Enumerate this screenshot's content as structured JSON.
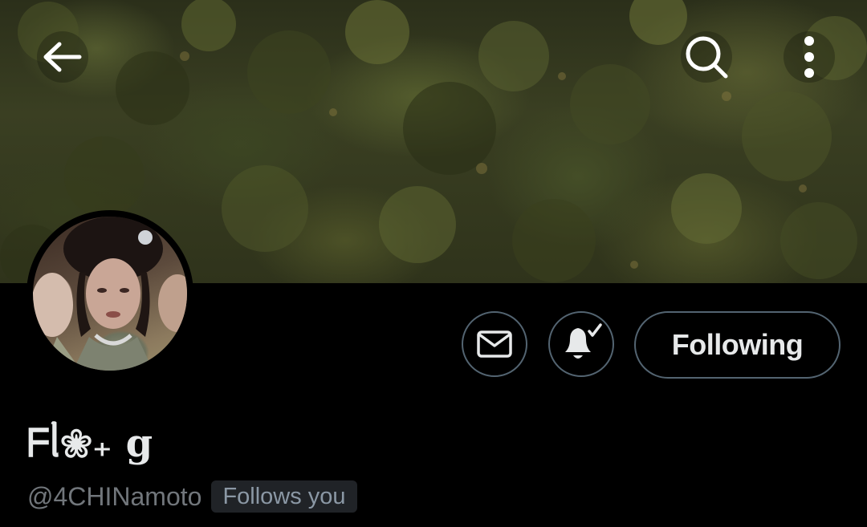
{
  "banner": {
    "back_icon": "arrow-left-icon",
    "search_icon": "search-icon",
    "more_icon": "more-vertical-icon"
  },
  "profile": {
    "display_name": "ᖴᥣ❀₊ g",
    "handle": "@4CHINamoto",
    "follows_you_badge": "Follows you"
  },
  "actions": {
    "message_icon": "mail-icon",
    "notifications_icon": "bell-check-icon",
    "following_label": "Following"
  },
  "colors": {
    "background": "#000000",
    "text_primary": "#e7e9ea",
    "text_secondary": "#71767b",
    "border": "#536471",
    "badge_background": "#202327"
  }
}
